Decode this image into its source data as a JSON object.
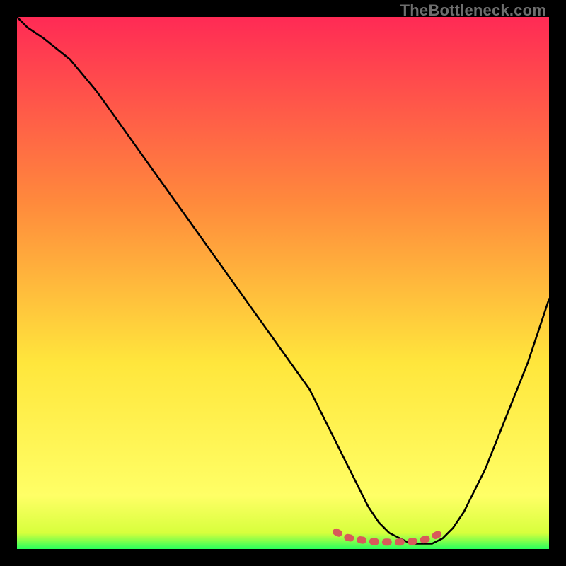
{
  "watermark": "TheBottleneck.com",
  "chart_data": {
    "type": "line",
    "title": "",
    "xlabel": "",
    "ylabel": "",
    "xlim": [
      0,
      100
    ],
    "ylim": [
      0,
      100
    ],
    "grid": false,
    "legend": false,
    "series": [
      {
        "name": "black-curve",
        "color": "#000000",
        "x": [
          0,
          2,
          5,
          10,
          15,
          20,
          25,
          30,
          35,
          40,
          45,
          50,
          55,
          60,
          62,
          64,
          66,
          68,
          70,
          72,
          74,
          76,
          78,
          80,
          82,
          84,
          86,
          88,
          90,
          92,
          94,
          96,
          98,
          100
        ],
        "y": [
          100,
          98,
          96,
          92,
          86,
          79,
          72,
          65,
          58,
          51,
          44,
          37,
          30,
          20,
          16,
          12,
          8,
          5,
          3,
          2,
          1,
          1,
          1,
          2,
          4,
          7,
          11,
          15,
          20,
          25,
          30,
          35,
          41,
          47
        ]
      },
      {
        "name": "red-flat-segment",
        "color": "#d85a5a",
        "x": [
          60,
          62,
          64,
          66,
          68,
          70,
          72,
          74,
          76,
          78,
          80
        ],
        "y": [
          3.2,
          2.2,
          1.8,
          1.5,
          1.3,
          1.3,
          1.3,
          1.4,
          1.6,
          2.2,
          3.2
        ]
      }
    ],
    "gradient_background": {
      "top": "#ff2a55",
      "mid1": "#ff8a3c",
      "mid2": "#ffe63c",
      "bottom_band": "#ffff66",
      "ground": "#29ff5c"
    }
  }
}
